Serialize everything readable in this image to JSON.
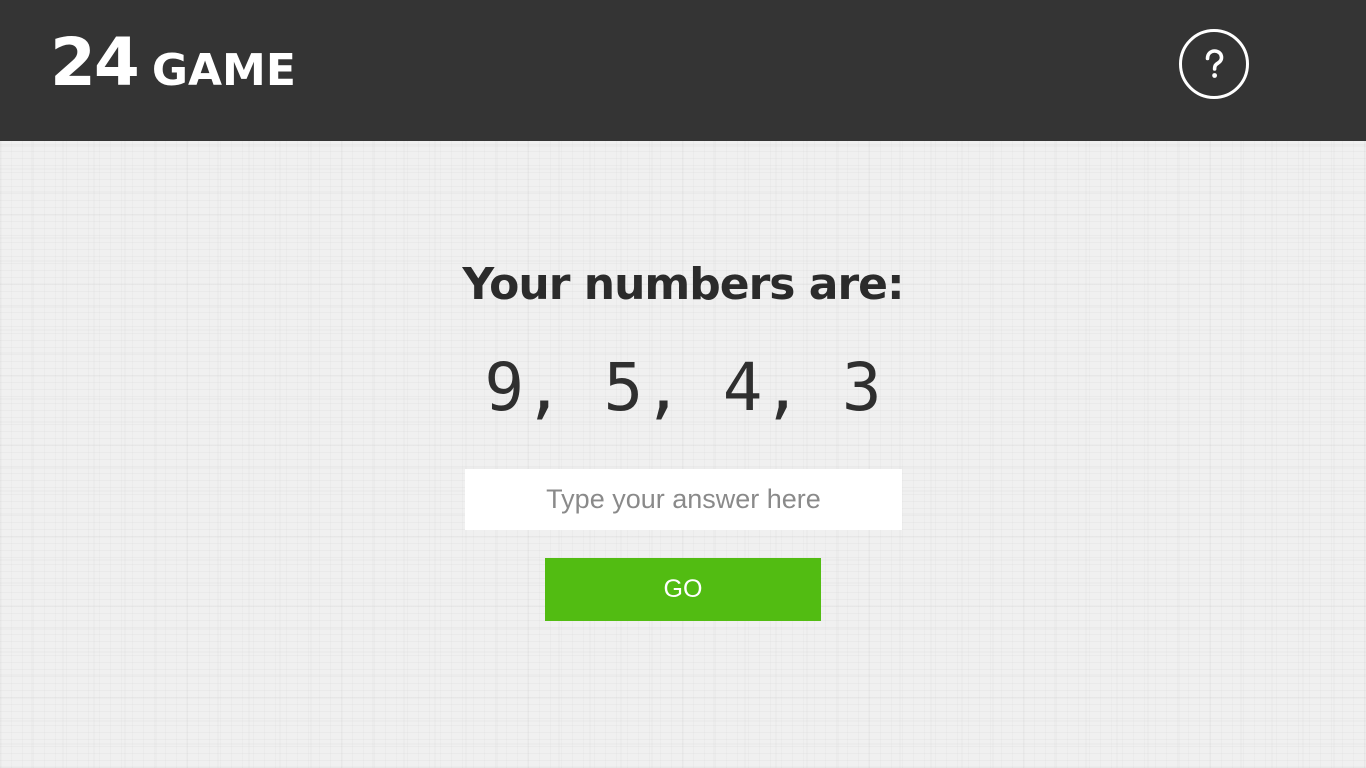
{
  "header": {
    "logo_number": "24",
    "logo_word": "GAME",
    "help_icon": "question-mark-icon"
  },
  "game": {
    "prompt": "Your numbers are:",
    "numbers_display": "9, 5, 4, 3",
    "numbers": [
      9,
      5,
      4,
      3
    ],
    "answer_value": "",
    "answer_placeholder": "Type your answer here",
    "submit_label": "GO"
  },
  "colors": {
    "header_bg": "#343434",
    "page_bg": "#f0f0f0",
    "submit_bg": "#52bc12",
    "text": "#2b2b2b"
  }
}
